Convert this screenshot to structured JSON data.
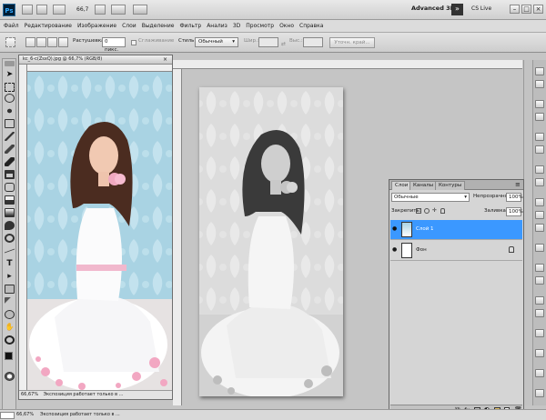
{
  "app": {
    "logo": "Ps",
    "zoom_menu": "66,7",
    "workspace": "Advanced 3D",
    "cs_live": "CS Live"
  },
  "menu": [
    "Файл",
    "Редактирование",
    "Изображение",
    "Слои",
    "Выделение",
    "Фильтр",
    "Анализ",
    "3D",
    "Просмотр",
    "Окно",
    "Справка"
  ],
  "options": {
    "feather_label": "Растушевка:",
    "feather_value": "0 пикс.",
    "smoothing_label": "Сглаживание",
    "style_label": "Стиль:",
    "style_value": "Обычный",
    "width_label": "Шир.:",
    "height_label": "Выс.:",
    "refine_button": "Уточн. край..."
  },
  "document": {
    "tab_title": "kc_6-c(ZsxQ).jpg @ 66,7% (RGB/8)",
    "zoom": "66,67%",
    "status": "Экспозиция работает только в ..."
  },
  "taskbar": {
    "zoom": "66,67%",
    "status": "Экспозиция работает только в ..."
  },
  "layers_panel": {
    "tabs": [
      "Слои",
      "Каналы",
      "Контуры"
    ],
    "active_tab": "Слои",
    "blend_mode": "Обычные",
    "opacity_label": "Непрозрачность:",
    "opacity_value": "100%",
    "lock_label": "Закрепить:",
    "fill_label": "Заливка:",
    "fill_value": "100%",
    "layers": [
      {
        "name": "Слой 1",
        "selected": true
      },
      {
        "name": "Фон",
        "selected": false
      }
    ]
  },
  "colors": {
    "selection_blue": "#3b98ff",
    "photo_bg": "#a9d3e3"
  }
}
